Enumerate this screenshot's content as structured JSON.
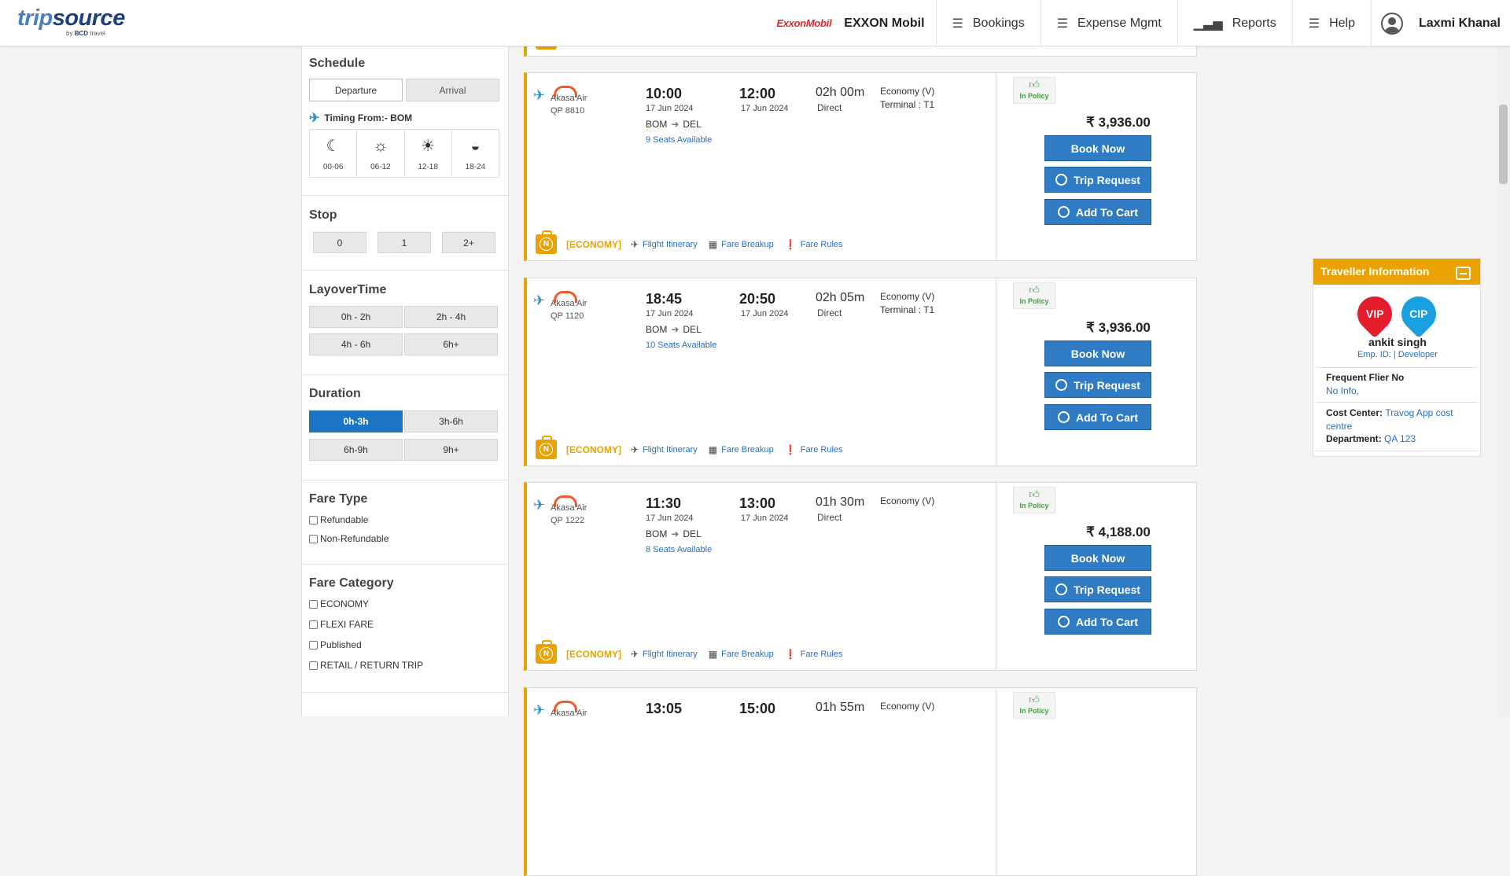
{
  "header": {
    "logo_main": "trip",
    "logo_src": "source",
    "logo_sub_by": "by",
    "logo_sub_bcd": "BCD",
    "logo_sub_travel": "travel",
    "brand_logo": "ExxonMobil",
    "company": "EXXON Mobil",
    "nav": [
      {
        "label": "Bookings",
        "icon": "menu-icon"
      },
      {
        "label": "Expense Mgmt",
        "icon": "menu-icon"
      },
      {
        "label": "Reports",
        "icon": "bar-chart-icon"
      },
      {
        "label": "Help",
        "icon": "menu-icon"
      }
    ],
    "user": "Laxmi Khanal"
  },
  "filters": {
    "schedule": {
      "title": "Schedule",
      "tabs": [
        "Departure",
        "Arrival"
      ],
      "timing_label": "Timing From:- BOM",
      "slots": [
        {
          "label": "00-06",
          "icon": "moon-icon"
        },
        {
          "label": "06-12",
          "icon": "sunrise-icon"
        },
        {
          "label": "12-18",
          "icon": "sun-icon"
        },
        {
          "label": "18-24",
          "icon": "sunset-icon"
        }
      ]
    },
    "stop": {
      "title": "Stop",
      "options": [
        "0",
        "1",
        "2+"
      ]
    },
    "layover": {
      "title": "LayoverTime",
      "options": [
        "0h - 2h",
        "2h - 4h",
        "4h - 6h",
        "6h+"
      ]
    },
    "duration": {
      "title": "Duration",
      "options": [
        "0h-3h",
        "3h-6h",
        "6h-9h",
        "9h+"
      ],
      "selected": "0h-3h"
    },
    "fare_type": {
      "title": "Fare Type",
      "options": [
        "Refundable",
        "Non-Refundable"
      ]
    },
    "fare_category": {
      "title": "Fare Category",
      "options": [
        "ECONOMY",
        "FLEXI FARE",
        "Published",
        "RETAIL / RETURN TRIP"
      ]
    }
  },
  "flights": [
    {
      "airline": "Akasa Air",
      "flight_no": "QP  8810",
      "dep_time": "10:00",
      "dep_date": "17 Jun 2024",
      "arr_time": "12:00",
      "arr_date": "17 Jun 2024",
      "from": "BOM",
      "to": "DEL",
      "seats": "9 Seats Available",
      "duration": "02h 00m",
      "stops": "Direct",
      "cabin": "Economy (V)",
      "terminal": "Terminal : T1",
      "policy": "In Policy",
      "price": "₹ 3,936.00",
      "fare_tag": "[ECONOMY]"
    },
    {
      "airline": "Akasa Air",
      "flight_no": "QP  1120",
      "dep_time": "18:45",
      "dep_date": "17 Jun 2024",
      "arr_time": "20:50",
      "arr_date": "17 Jun 2024",
      "from": "BOM",
      "to": "DEL",
      "seats": "10 Seats Available",
      "duration": "02h 05m",
      "stops": "Direct",
      "cabin": "Economy (V)",
      "terminal": "Terminal : T1",
      "policy": "In Policy",
      "price": "₹ 3,936.00",
      "fare_tag": "[ECONOMY]"
    },
    {
      "airline": "Akasa Air",
      "flight_no": "QP  1222",
      "dep_time": "11:30",
      "dep_date": "17 Jun 2024",
      "arr_time": "13:00",
      "arr_date": "17 Jun 2024",
      "from": "BOM",
      "to": "DEL",
      "seats": "8 Seats Available",
      "duration": "01h 30m",
      "stops": "Direct",
      "cabin": "Economy (V)",
      "terminal": "",
      "policy": "In Policy",
      "price": "₹ 4,188.00",
      "fare_tag": "[ECONOMY]"
    },
    {
      "airline": "Akasa Air",
      "flight_no": "",
      "dep_time": "13:05",
      "dep_date": "",
      "arr_time": "15:00",
      "arr_date": "",
      "from": "",
      "to": "",
      "seats": "",
      "duration": "01h 55m",
      "stops": "",
      "cabin": "Economy (V)",
      "terminal": "",
      "policy": "In Policy",
      "price": "",
      "fare_tag": ""
    }
  ],
  "card_actions": {
    "book": "Book Now",
    "trip": "Trip Request",
    "cart": "Add To Cart"
  },
  "card_links": {
    "itinerary": "Flight Itinerary",
    "breakup": "Fare Breakup",
    "rules": "Fare Rules"
  },
  "traveller": {
    "title": "Traveller Information",
    "badges": [
      "VIP",
      "CIP"
    ],
    "name": "ankit singh",
    "emp": "Emp. ID: | Developer",
    "ff_label": "Frequent Flier No",
    "ff_value": "No Info,",
    "cc_label": "Cost Center",
    "cc_value": "Travog App cost centre",
    "dept_label": "Department",
    "dept_value": "QA 123"
  }
}
